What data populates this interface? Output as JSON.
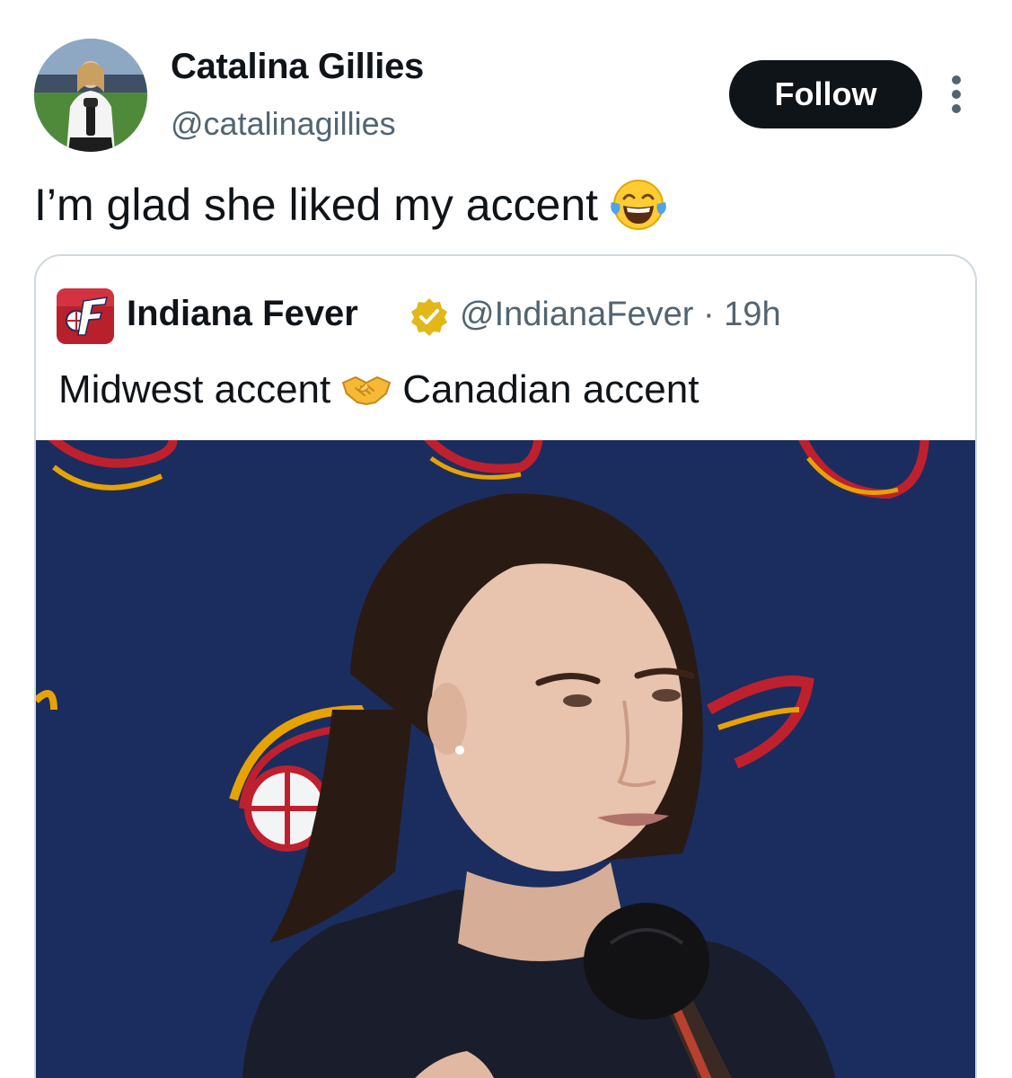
{
  "tweet": {
    "author": {
      "name": "Catalina Gillies",
      "handle": "@catalinagillies",
      "avatar_icon": "profile-photo"
    },
    "follow_label": "Follow",
    "more_icon": "more-vertical-icon",
    "text": "I’m glad she liked my accent",
    "emoji": "face-with-tears-of-joy"
  },
  "quote": {
    "author": {
      "name": "Indiana Fever",
      "handle": "@IndianaFever",
      "separator": "·",
      "time": "19h",
      "logo_icon": "indiana-fever-logo",
      "verified_icon": "gold-verified-badge-icon"
    },
    "text_left": "Midwest accent",
    "emoji": "handshake",
    "text_right": "Canadian accent",
    "media": "press-conference-video-still"
  },
  "colors": {
    "text_primary": "#0f1419",
    "text_secondary": "#536471",
    "follow_bg": "#0f1419",
    "border": "#cfd9de",
    "verified_gold": "#e2b719",
    "backdrop_navy": "#1b2d5e"
  }
}
